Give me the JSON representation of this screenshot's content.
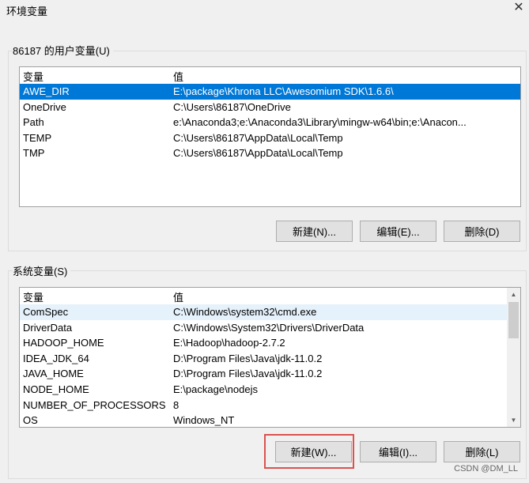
{
  "window": {
    "title": "环境变量",
    "close_glyph": "✕"
  },
  "user_vars": {
    "group_label": "86187 的用户变量(U)",
    "col_name": "变量",
    "col_value": "值",
    "rows": [
      {
        "name": "AWE_DIR",
        "value": "E:\\package\\Khrona LLC\\Awesomium SDK\\1.6.6\\"
      },
      {
        "name": "OneDrive",
        "value": "C:\\Users\\86187\\OneDrive"
      },
      {
        "name": "Path",
        "value": "e:\\Anaconda3;e:\\Anaconda3\\Library\\mingw-w64\\bin;e:\\Anacon..."
      },
      {
        "name": "TEMP",
        "value": "C:\\Users\\86187\\AppData\\Local\\Temp"
      },
      {
        "name": "TMP",
        "value": "C:\\Users\\86187\\AppData\\Local\\Temp"
      }
    ],
    "new_label": "新建(N)...",
    "edit_label": "编辑(E)...",
    "delete_label": "删除(D)"
  },
  "system_vars": {
    "group_label": "系统变量(S)",
    "col_name": "变量",
    "col_value": "值",
    "rows": [
      {
        "name": "ComSpec",
        "value": "C:\\Windows\\system32\\cmd.exe"
      },
      {
        "name": "DriverData",
        "value": "C:\\Windows\\System32\\Drivers\\DriverData"
      },
      {
        "name": "HADOOP_HOME",
        "value": "E:\\Hadoop\\hadoop-2.7.2"
      },
      {
        "name": "IDEA_JDK_64",
        "value": "D:\\Program Files\\Java\\jdk-11.0.2"
      },
      {
        "name": "JAVA_HOME",
        "value": "D:\\Program Files\\Java\\jdk-11.0.2"
      },
      {
        "name": "NODE_HOME",
        "value": "E:\\package\\nodejs"
      },
      {
        "name": "NUMBER_OF_PROCESSORS",
        "value": "8"
      },
      {
        "name": "OS",
        "value": "Windows_NT"
      }
    ],
    "new_label": "新建(W)...",
    "edit_label": "编辑(I)...",
    "delete_label": "删除(L)"
  },
  "scroll_up_glyph": "▲",
  "scroll_down_glyph": "▼",
  "watermark": "CSDN @DM_LL",
  "colors": {
    "selection": "#0078d7",
    "highlight_box": "#d9534f"
  }
}
